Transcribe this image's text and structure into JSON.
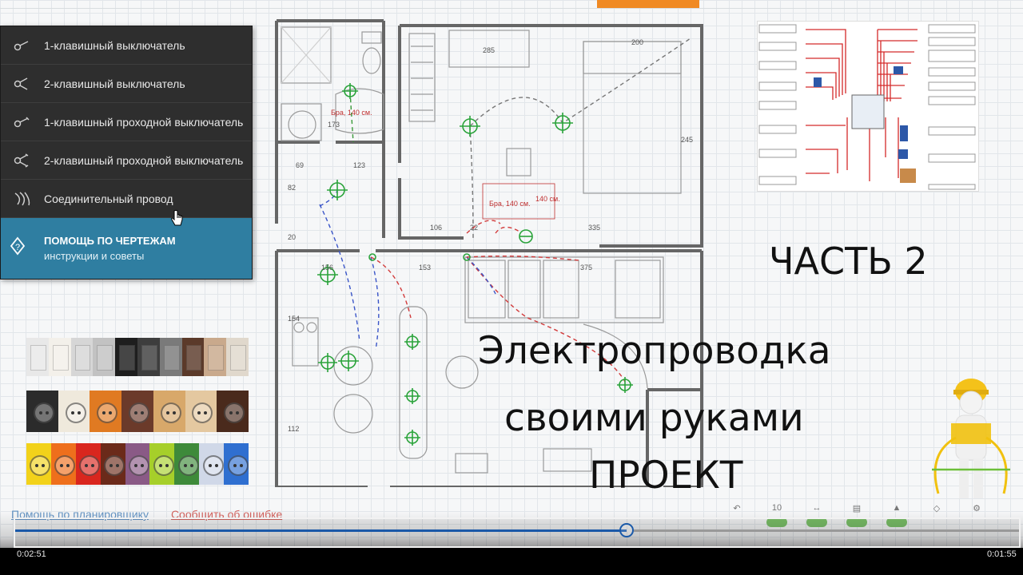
{
  "menu": {
    "items": [
      {
        "label": "1-клавишный выключатель",
        "icon": "switch-1-icon"
      },
      {
        "label": "2-клавишный выключатель",
        "icon": "switch-2-icon"
      },
      {
        "label": "1-клавишный проходной выключатель",
        "icon": "pass-switch-1-icon"
      },
      {
        "label": "2-клавишный проходной выключатель",
        "icon": "pass-switch-2-icon"
      },
      {
        "label": "Соединительный провод",
        "icon": "wire-icon"
      }
    ],
    "help": {
      "title": "ПОМОЩЬ ПО ЧЕРТЕЖАМ",
      "subtitle": "инструкции и советы",
      "icon": "help-icon"
    }
  },
  "plan": {
    "labels": {
      "bra1": "Бра, 140 см.",
      "bra2": "Бра, 140 см.",
      "h140": "140 см.",
      "d285": "285",
      "d200": "200",
      "d245": "245",
      "d173": "173",
      "d69": "69",
      "d123": "123",
      "d82": "82",
      "d20": "20",
      "d106": "106",
      "d22": "22",
      "d335": "335",
      "d156": "156",
      "d153": "153",
      "d375": "375",
      "d154": "154",
      "d112": "112"
    }
  },
  "overlay": {
    "part": "ЧАСТЬ 2",
    "line1": "Электропроводка",
    "line2": "своими руками",
    "line3": "ПРОЕКТ"
  },
  "bottom": {
    "help_link": "Помощь по планировщику",
    "error_link": "Сообщить об ошибке",
    "zoom": "10"
  },
  "player": {
    "current_time": "0:02:51",
    "duration": "0:01:55",
    "progress": 0.609
  },
  "colors": {
    "accent_orange": "#f08a24",
    "menu_bg": "#2e2e2e",
    "help_bg": "#2f7ea1",
    "plan_green": "#2aa33a",
    "wire_red": "#d23a3a",
    "wire_blue": "#3a55c8",
    "progress_blue": "#1a59a8"
  }
}
